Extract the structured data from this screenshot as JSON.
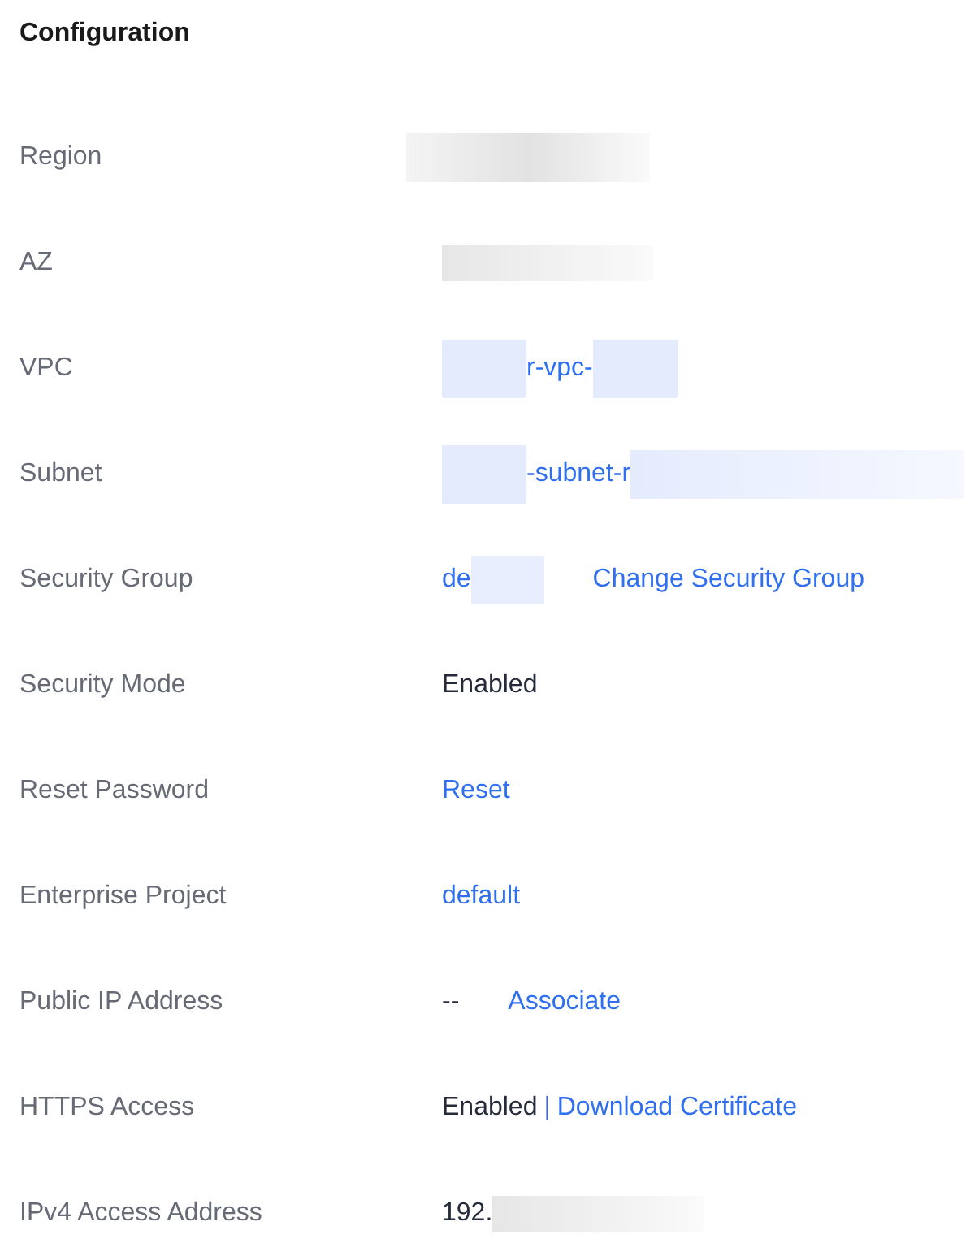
{
  "title": "Configuration",
  "rows": [
    {
      "label": "Region",
      "value": [
        {
          "kind": "mask_wide"
        }
      ]
    },
    {
      "label": "AZ",
      "value": [
        {
          "kind": "mask"
        }
      ]
    },
    {
      "label": "VPC",
      "value": [
        {
          "kind": "link_mask"
        },
        {
          "kind": "link",
          "text": "r-vpc-"
        },
        {
          "kind": "link_mask"
        }
      ]
    },
    {
      "label": "Subnet",
      "value": [
        {
          "kind": "link_mask"
        },
        {
          "kind": "link",
          "text": "-subnet-r"
        },
        {
          "kind": "link_mask_wide"
        }
      ]
    },
    {
      "label": "Security Group",
      "value": [
        {
          "kind": "link",
          "text": "de"
        },
        {
          "kind": "link_mask_small"
        },
        {
          "kind": "action",
          "text": "Change Security Group"
        }
      ]
    },
    {
      "label": "Security Mode",
      "value": [
        {
          "kind": "text",
          "text": "Enabled"
        }
      ]
    },
    {
      "label": "Reset Password",
      "value": [
        {
          "kind": "link",
          "text": "Reset"
        }
      ]
    },
    {
      "label": "Enterprise Project",
      "value": [
        {
          "kind": "link",
          "text": "default"
        }
      ]
    },
    {
      "label": "Public IP Address",
      "value": [
        {
          "kind": "text",
          "text": "--"
        },
        {
          "kind": "action",
          "text": "Associate"
        }
      ]
    },
    {
      "label": "HTTPS Access",
      "value": [
        {
          "kind": "text",
          "text": "Enabled"
        },
        {
          "kind": "separator",
          "text": "|"
        },
        {
          "kind": "link",
          "text": "Download Certificate"
        }
      ]
    },
    {
      "label": "IPv4 Access Address",
      "value": [
        {
          "kind": "text",
          "text": "192."
        },
        {
          "kind": "mask"
        }
      ]
    }
  ]
}
